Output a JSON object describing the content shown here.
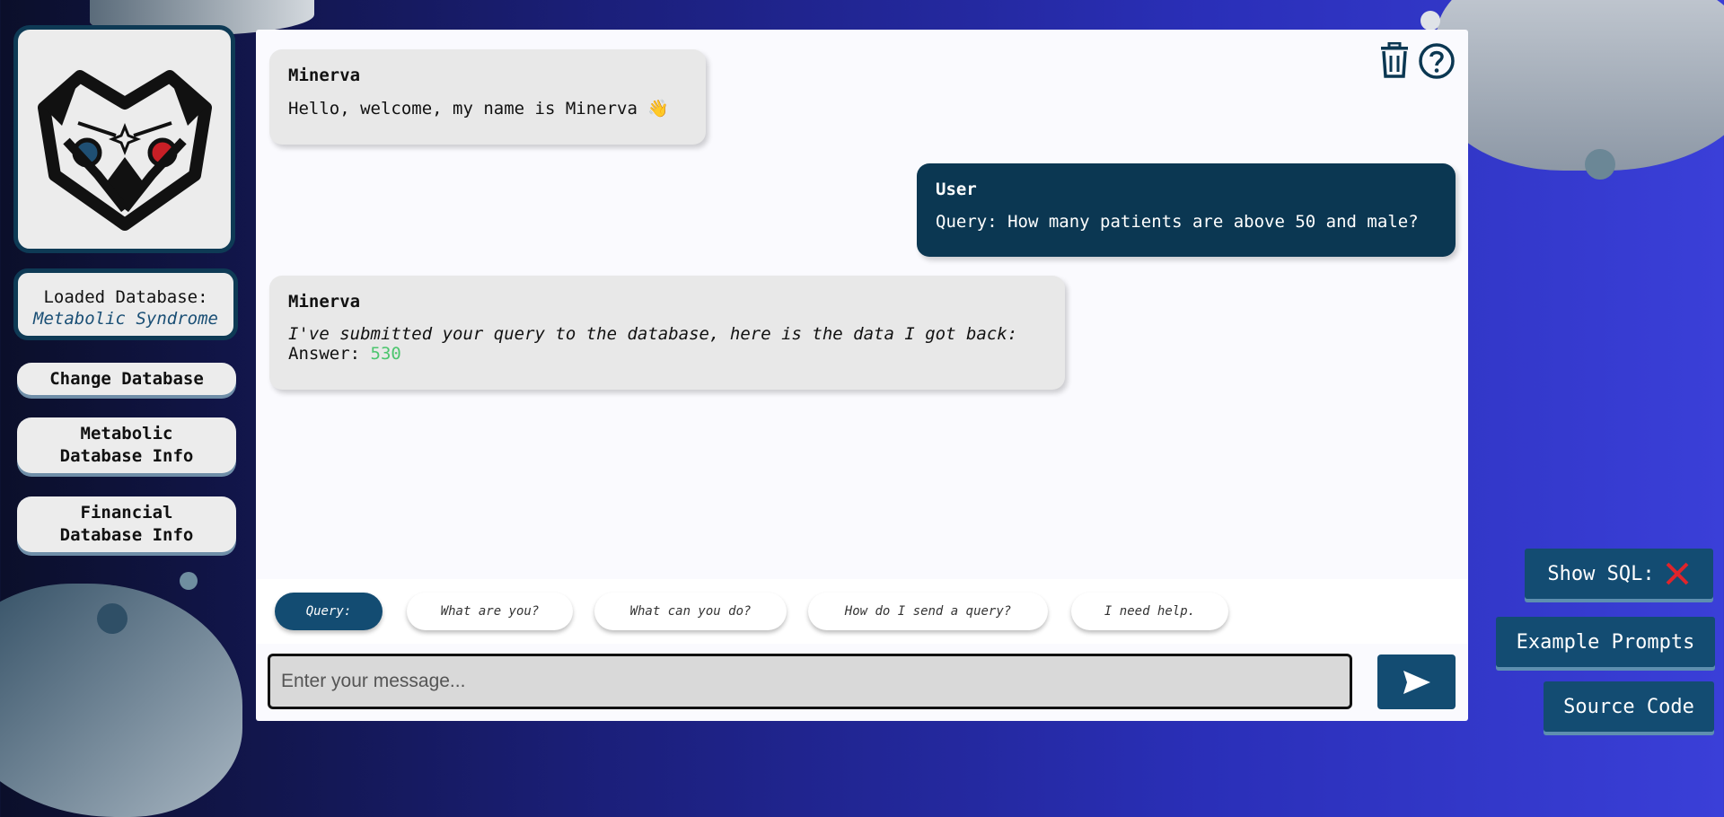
{
  "sidebar": {
    "logo_alt": "owl-logo",
    "loaded_db_label": "Loaded Database:",
    "loaded_db_name": "Metabolic Syndrome",
    "buttons": [
      {
        "label": "Change Database"
      },
      {
        "label_line1": "Metabolic",
        "label_line2": "Database Info"
      },
      {
        "label_line1": "Financial",
        "label_line2": "Database Info"
      }
    ]
  },
  "chat": {
    "messages": [
      {
        "sender": "Minerva",
        "text": "Hello, welcome, my name is Minerva 👋"
      },
      {
        "sender": "User",
        "text": "Query: How many patients are above 50 and male?"
      },
      {
        "sender": "Minerva",
        "text_italic": "I've submitted your query to the database, here is the data I got back:",
        "answer_label": "Answer:",
        "answer_value": "530"
      }
    ],
    "chips": [
      "Query:",
      "What are you?",
      "What can you do?",
      "How do I send a query?",
      "I need help."
    ],
    "input_placeholder": "Enter your message..."
  },
  "floating": {
    "show_sql": "Show SQL:",
    "example_prompts": "Example Prompts",
    "source_code": "Source Code"
  },
  "colors": {
    "accent": "#134c72",
    "user_bubble": "#0b3752",
    "answer": "#4cc56e",
    "close_x": "#e0242b"
  },
  "icons": [
    "trash-icon",
    "help-icon",
    "send-icon",
    "close-x-icon"
  ]
}
